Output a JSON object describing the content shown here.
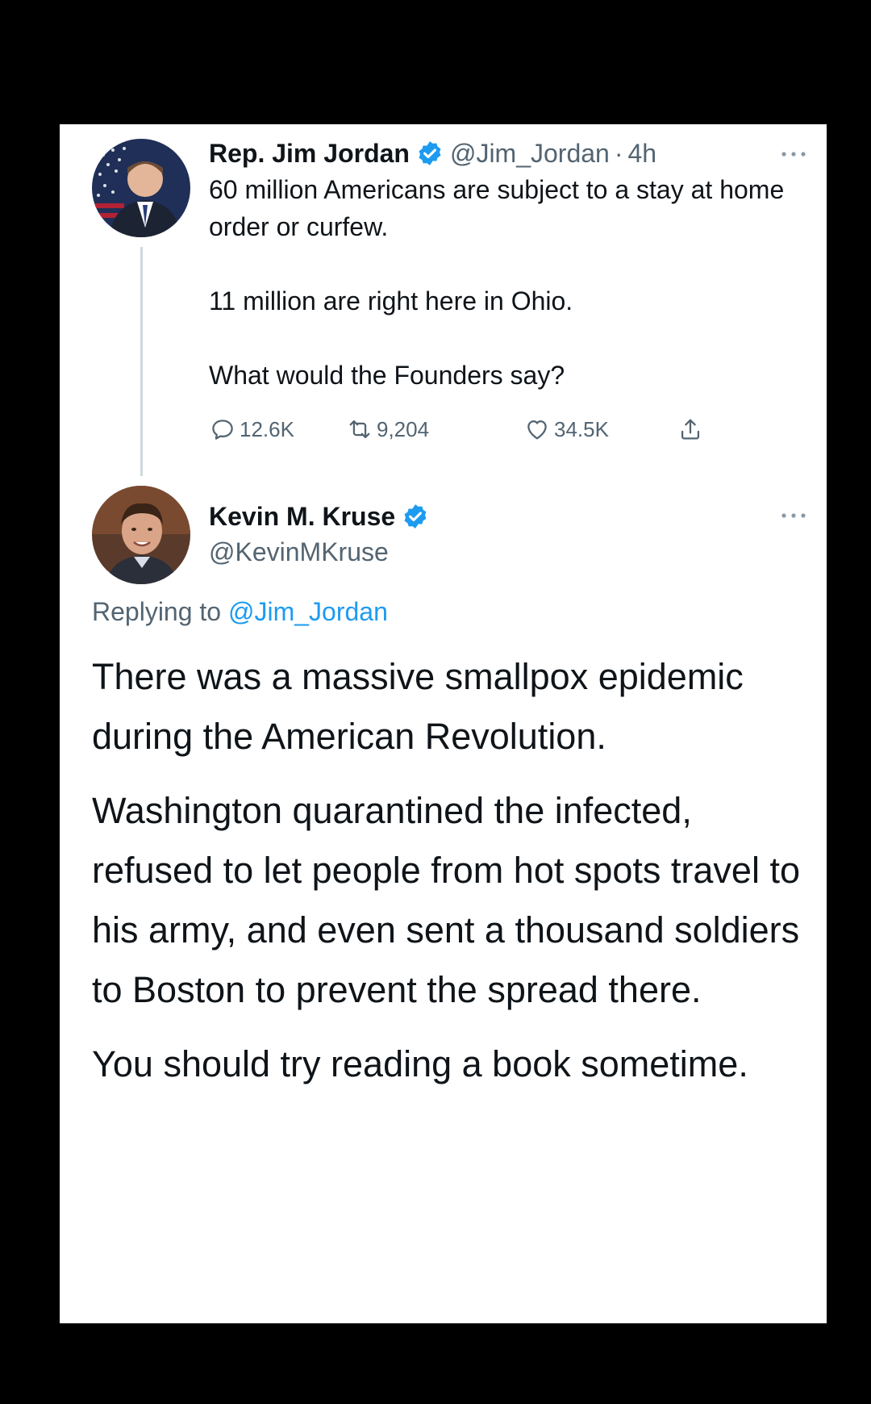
{
  "tweet1": {
    "name": "Rep. Jim Jordan",
    "handle": "@Jim_Jordan",
    "separator": "·",
    "time": "4h",
    "text_lines": [
      "60 million Americans are subject to a stay at home order or curfew.",
      "11 million are right here in Ohio.",
      "What would the Founders say?"
    ],
    "actions": {
      "replies": "12.6K",
      "retweets": "9,204",
      "likes": "34.5K"
    }
  },
  "tweet2": {
    "name": "Kevin M. Kruse",
    "handle": "@KevinMKruse",
    "replying_prefix": "Replying to",
    "replying_to": "@Jim_Jordan",
    "paragraphs": [
      "There was a massive smallpox epidemic during the American Revolution.",
      "Washington quarantined the infected, refused to let people from hot spots travel to his army, and even sent a thousand soldiers to Boston to prevent the spread there.",
      "You should try reading a book sometime."
    ]
  },
  "colors": {
    "verified_blue": "#1d9bf0",
    "secondary_text": "#536471",
    "primary_text": "#0f1419",
    "thread_line": "#cfd9de"
  },
  "icons": {
    "verified": "verified-badge-icon",
    "more": "more-options-icon",
    "reply": "reply-icon",
    "retweet": "retweet-icon",
    "like": "like-icon",
    "share": "share-icon"
  }
}
